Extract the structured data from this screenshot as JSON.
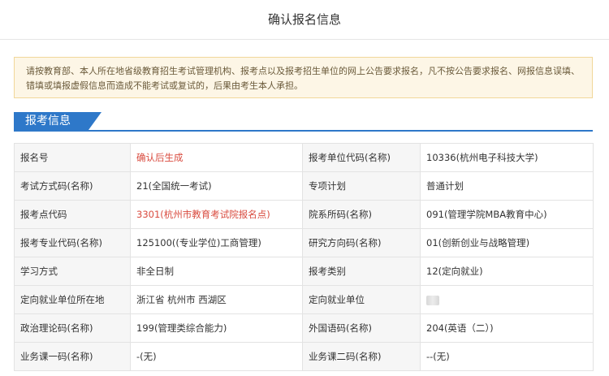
{
  "page": {
    "title": "确认报名信息"
  },
  "notice": {
    "text": "请按教育部、本人所在地省级教育招生考试管理机构、报考点以及报考招生单位的网上公告要求报名，凡不按公告要求报名、网报信息误填、错填或填报虚假信息而造成不能考试或复试的，后果由考生本人承担。"
  },
  "section": {
    "title": "报考信息"
  },
  "rows": [
    {
      "l1": "报名号",
      "v1": "确认后生成",
      "l2": "报考单位代码(名称)",
      "v2": "10336(杭州电子科技大学)"
    },
    {
      "l1": "考试方式码(名称)",
      "v1": "21(全国统一考试)",
      "l2": "专项计划",
      "v2": "普通计划"
    },
    {
      "l1": "报考点代码",
      "v1": "3301(杭州市教育考试院报名点)",
      "l2": "院系所码(名称)",
      "v2": "091(管理学院MBA教育中心)"
    },
    {
      "l1": "报考专业代码(名称)",
      "v1": "125100((专业学位)工商管理)",
      "l2": "研究方向码(名称)",
      "v2": "01(创新创业与战略管理)"
    },
    {
      "l1": "学习方式",
      "v1": "非全日制",
      "l2": "报考类别",
      "v2": "12(定向就业)"
    },
    {
      "l1": "定向就业单位所在地",
      "v1": "浙江省 杭州市 西湖区",
      "l2": "定向就业单位",
      "v2": ""
    },
    {
      "l1": "政治理论码(名称)",
      "v1": "199(管理类综合能力)",
      "l2": "外国语码(名称)",
      "v2": "204(英语（二）)"
    },
    {
      "l1": "业务课一码(名称)",
      "v1": "-(无)",
      "l2": "业务课二码(名称)",
      "v2": "--(无)"
    }
  ],
  "colors": {
    "accent": "#2e78c9",
    "highlight": "#d94b3f",
    "notice_bg": "#fdf6e6"
  }
}
